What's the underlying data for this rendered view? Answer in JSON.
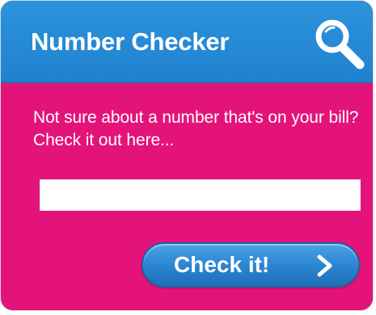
{
  "header": {
    "title": "Number Checker",
    "icon": "magnifier-icon"
  },
  "body": {
    "description": "Not sure about a number that's on your bill? Check it out here..."
  },
  "input": {
    "value": "",
    "placeholder": ""
  },
  "button": {
    "label": "Check it!",
    "icon": "chevron-right-icon"
  },
  "colors": {
    "panel_background": "#e4137a",
    "header_background": "#2289d3",
    "button_background": "#2c86d2",
    "text": "#ffffff"
  }
}
